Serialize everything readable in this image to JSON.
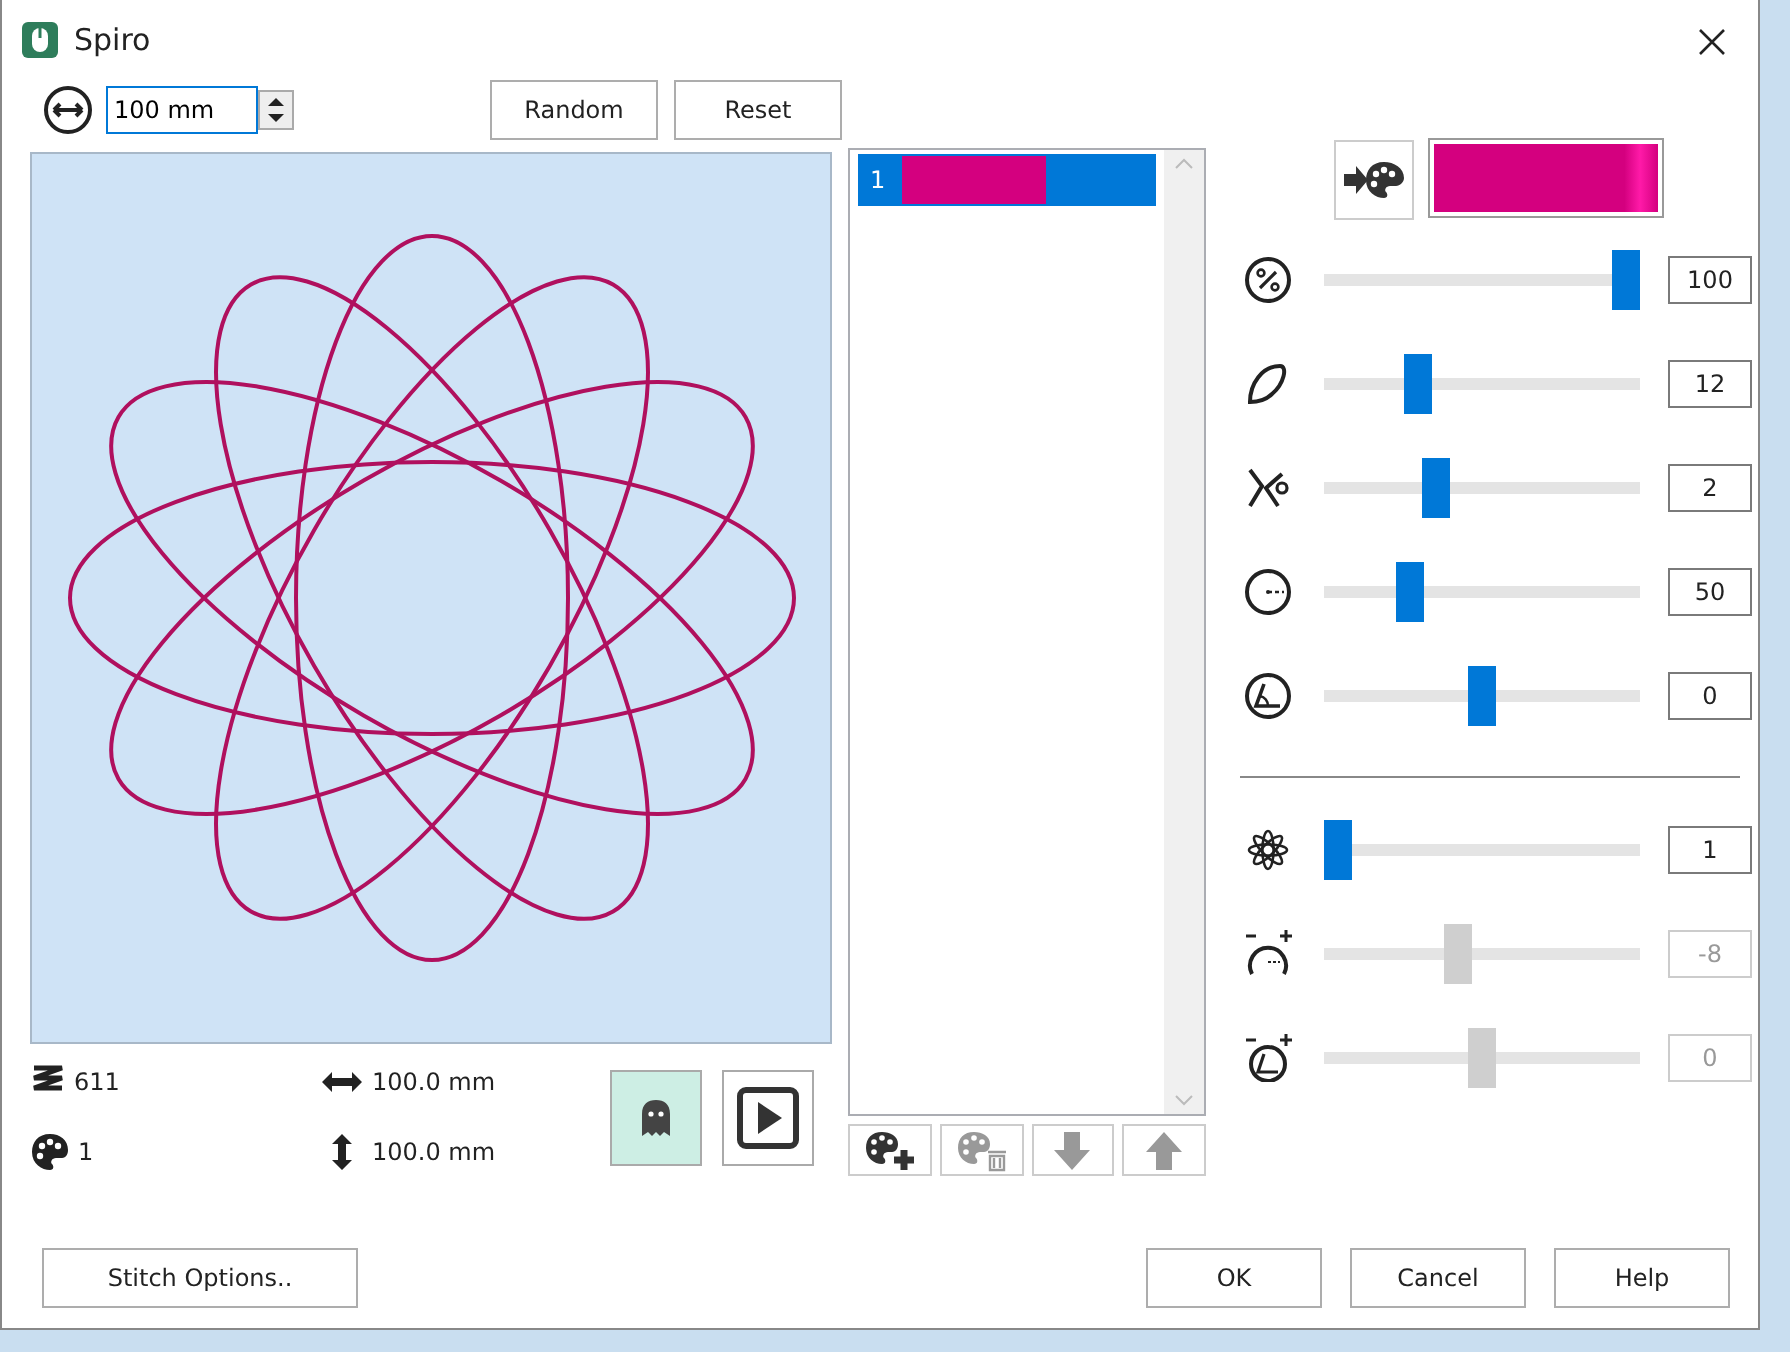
{
  "window": {
    "title": "Spiro"
  },
  "size_field": {
    "value": "100 mm"
  },
  "top_buttons": [
    "Random",
    "Reset"
  ],
  "stats": {
    "stitches": "611",
    "colors": "1",
    "width": "100.0 mm",
    "height": "100.0 mm"
  },
  "view_buttons": [
    {
      "kind": "ghost",
      "selected": true
    },
    {
      "kind": "play",
      "selected": false
    }
  ],
  "color_list": [
    {
      "label": "1",
      "color": "#d4007f",
      "selected": true
    }
  ],
  "list_tools": [
    {
      "kind": "add",
      "disabled": false
    },
    {
      "kind": "delete",
      "disabled": true
    },
    {
      "kind": "down",
      "disabled": true
    },
    {
      "kind": "up",
      "disabled": true
    }
  ],
  "current_color": {
    "color": "#d4007f"
  },
  "sliders": [
    {
      "level": 1,
      "value": "100",
      "disabled": false
    },
    {
      "level": 0.28,
      "value": "12",
      "disabled": false
    },
    {
      "level": 0.34,
      "value": "2",
      "disabled": false
    },
    {
      "level": 0.25,
      "value": "50",
      "disabled": false
    },
    {
      "level": 0.5,
      "value": "0",
      "disabled": false
    }
  ],
  "sliders_2": [
    {
      "level": 0,
      "value": "1",
      "disabled": false
    },
    {
      "level": 0.42,
      "value": "-8",
      "disabled": true
    },
    {
      "level": 0.5,
      "value": "0",
      "disabled": true
    }
  ],
  "bottom_buttons": [
    "Stitch Options..",
    "OK",
    "Cancel",
    "Help"
  ]
}
